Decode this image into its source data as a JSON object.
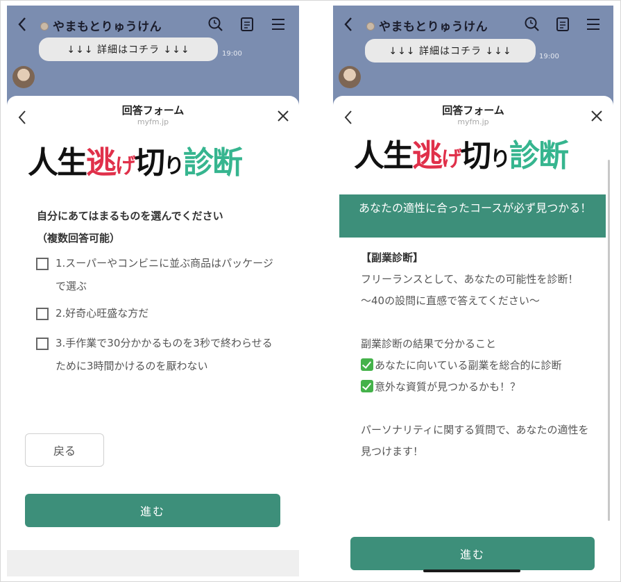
{
  "chat": {
    "name": "やまもとりゅうけん",
    "message": "↓↓↓ 詳細はコチラ ↓↓↓",
    "time": "19:00"
  },
  "sheet": {
    "title": "回答フォーム",
    "url": "myfm.jp"
  },
  "logo": {
    "part1": "人生",
    "part2": "逃",
    "part3": "げ",
    "part4": "切",
    "part5": "り",
    "part6": "診断"
  },
  "left": {
    "question_line1": "自分にあてはまるものを選んでください",
    "question_line2": "（複数回答可能）",
    "options": [
      "1.スーパーやコンビニに並ぶ商品はパッケージで選ぶ",
      "2.好奇心旺盛な方だ",
      "3.手作業で30分かかるものを3秒で終わらせるために3時間かけるのを厭わない"
    ],
    "back_label": "戻る",
    "next_label": "進む"
  },
  "right": {
    "banner": "あなたの適性に合ったコースが必ず見つかる！",
    "heading": "【副業診断】",
    "para1_line1": "フリーランスとして、あなたの可能性を診断！",
    "para1_line2": "〜40の設問に直感で答えてください〜",
    "para2_title": "副業診断の結果で分かること",
    "bullet1": "あなたに向いている副業を総合的に診断",
    "bullet2": "意外な資質が見つかるかも！？",
    "para3": "パーソナリティに関する質問で、あなたの適性を見つけます！",
    "next_label": "進む"
  },
  "colors": {
    "accent": "#3d8f7a",
    "logo_red": "#e0304a",
    "logo_green": "#36b58f",
    "chat_bg": "#7b8db0"
  }
}
